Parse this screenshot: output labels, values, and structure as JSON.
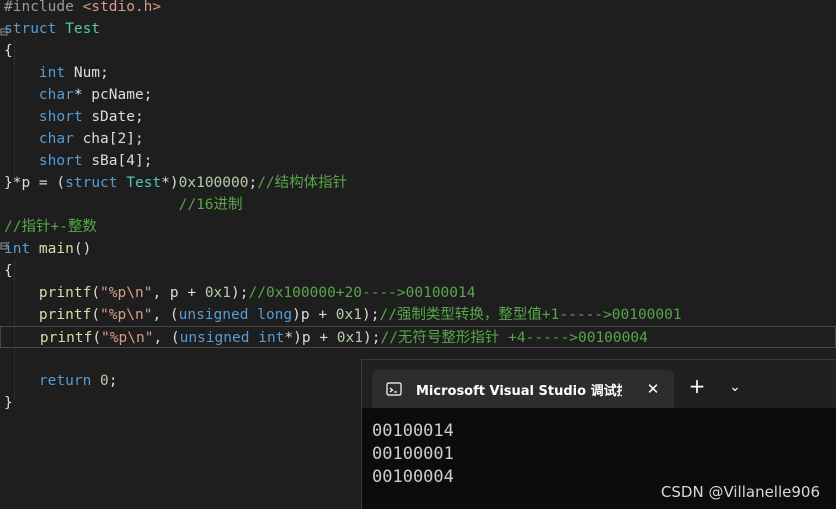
{
  "editor": {
    "code_lines": [
      [
        {
          "t": "#include ",
          "c": "pp"
        },
        {
          "t": "<stdio.h>",
          "c": "str"
        }
      ],
      [
        {
          "t": "struct ",
          "c": "kw"
        },
        {
          "t": "Test",
          "c": "ty"
        }
      ],
      [
        {
          "t": "{",
          "c": "tx"
        }
      ],
      [
        {
          "t": "    ",
          "c": "tx"
        },
        {
          "t": "int ",
          "c": "kw"
        },
        {
          "t": "Num;",
          "c": "var"
        }
      ],
      [
        {
          "t": "    ",
          "c": "tx"
        },
        {
          "t": "char",
          "c": "kw"
        },
        {
          "t": "* pcName;",
          "c": "var"
        }
      ],
      [
        {
          "t": "    ",
          "c": "tx"
        },
        {
          "t": "short ",
          "c": "kw"
        },
        {
          "t": "sDate;",
          "c": "var"
        }
      ],
      [
        {
          "t": "    ",
          "c": "tx"
        },
        {
          "t": "char ",
          "c": "kw"
        },
        {
          "t": "cha[2];",
          "c": "var"
        }
      ],
      [
        {
          "t": "    ",
          "c": "tx"
        },
        {
          "t": "short ",
          "c": "kw"
        },
        {
          "t": "sBa[4];",
          "c": "var"
        }
      ],
      [
        {
          "t": "}",
          "c": "tx"
        },
        {
          "t": "*p = (",
          "c": "tx"
        },
        {
          "t": "struct ",
          "c": "kw"
        },
        {
          "t": "Test",
          "c": "ty"
        },
        {
          "t": "*)",
          "c": "tx"
        },
        {
          "t": "0x100000",
          "c": "num"
        },
        {
          "t": ";",
          "c": "tx"
        },
        {
          "t": "//结构体指针",
          "c": "cm"
        }
      ],
      [
        {
          "t": "                    ",
          "c": "tx"
        },
        {
          "t": "//16进制",
          "c": "cm"
        }
      ],
      [
        {
          "t": "//指针+-整数",
          "c": "cm"
        }
      ],
      [
        {
          "t": "int ",
          "c": "kw"
        },
        {
          "t": "main",
          "c": "fn"
        },
        {
          "t": "()",
          "c": "tx"
        }
      ],
      [
        {
          "t": "{",
          "c": "tx"
        }
      ],
      [
        {
          "t": "    ",
          "c": "tx"
        },
        {
          "t": "printf",
          "c": "fn"
        },
        {
          "t": "(",
          "c": "tx"
        },
        {
          "t": "\"%p\\n\"",
          "c": "str"
        },
        {
          "t": ", p + ",
          "c": "tx"
        },
        {
          "t": "0x1",
          "c": "num"
        },
        {
          "t": ");",
          "c": "tx"
        },
        {
          "t": "//0x100000+20---->00100014",
          "c": "cm"
        }
      ],
      [
        {
          "t": "    ",
          "c": "tx"
        },
        {
          "t": "printf",
          "c": "fn"
        },
        {
          "t": "(",
          "c": "tx"
        },
        {
          "t": "\"%p\\n\"",
          "c": "str"
        },
        {
          "t": ", (",
          "c": "tx"
        },
        {
          "t": "unsigned long",
          "c": "kw"
        },
        {
          "t": ")p + ",
          "c": "tx"
        },
        {
          "t": "0x1",
          "c": "num"
        },
        {
          "t": ");",
          "c": "tx"
        },
        {
          "t": "//强制类型转换，整型值+1----->00100001",
          "c": "cm"
        }
      ],
      [
        {
          "t": "    ",
          "c": "tx"
        },
        {
          "t": "printf",
          "c": "fn"
        },
        {
          "t": "(",
          "c": "tx"
        },
        {
          "t": "\"%p\\n\"",
          "c": "str"
        },
        {
          "t": ", (",
          "c": "tx"
        },
        {
          "t": "unsigned int",
          "c": "kw"
        },
        {
          "t": "*)p + ",
          "c": "tx"
        },
        {
          "t": "0x1",
          "c": "num"
        },
        {
          "t": ");",
          "c": "tx"
        },
        {
          "t": "//无符号整形指针 +4----->00100004",
          "c": "cm"
        }
      ],
      [],
      [
        {
          "t": "    ",
          "c": "tx"
        },
        {
          "t": "return ",
          "c": "kw"
        },
        {
          "t": "0",
          "c": "num"
        },
        {
          "t": ";",
          "c": "tx"
        }
      ],
      [
        {
          "t": "}",
          "c": "tx"
        }
      ]
    ]
  },
  "console": {
    "tab_title": "Microsoft Visual Studio 调试控制台",
    "close_glyph": "✕",
    "new_tab_glyph": "+",
    "dropdown_glyph": "⌄",
    "output_lines": [
      "00100014",
      "00100001",
      "00100004"
    ]
  },
  "watermark": "CSDN @Villanelle906",
  "colors": {
    "background": "#1e1e1e",
    "keyword": "#569cd6",
    "type": "#4ec9b0",
    "string": "#d69d85",
    "number": "#b5cea8",
    "comment": "#57a64a",
    "function": "#dcdcaa"
  }
}
